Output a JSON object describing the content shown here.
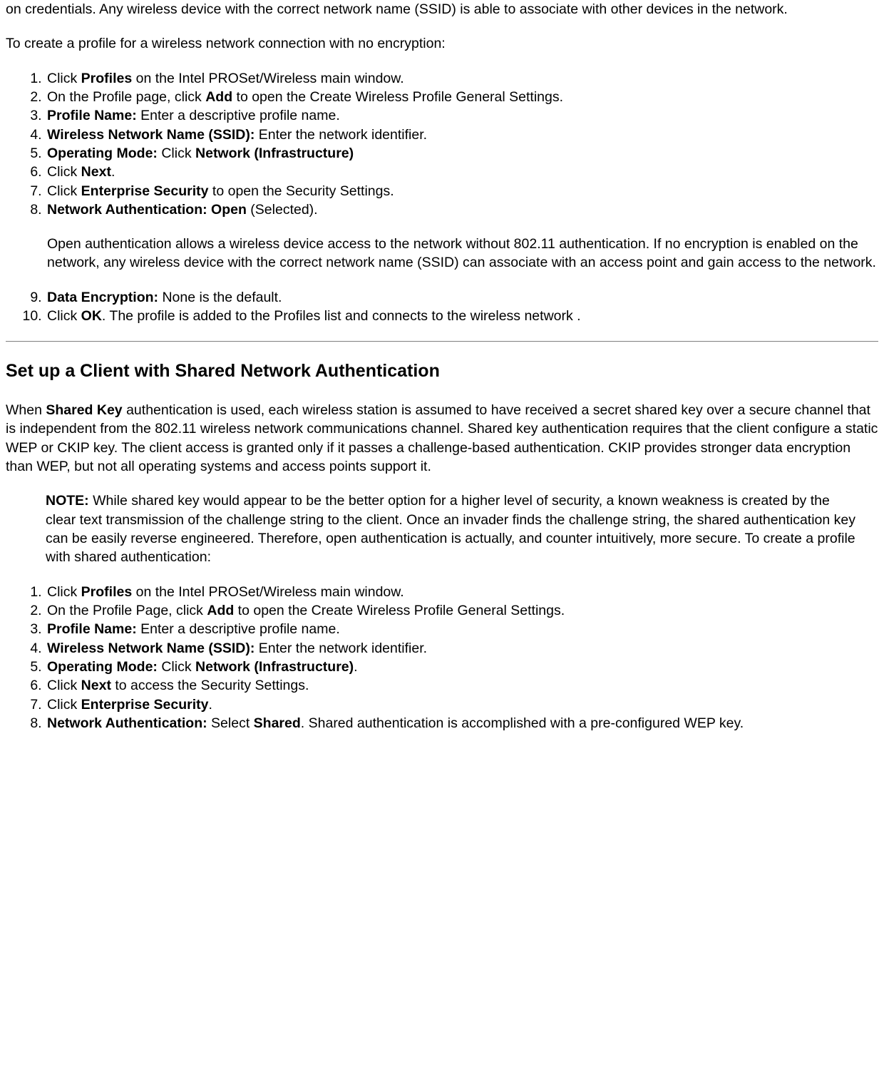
{
  "intro": {
    "p1": "on credentials. Any wireless device with the correct network name (SSID) is able to associate with other devices in the network.",
    "p2": "To create a profile for a wireless network connection with no encryption:"
  },
  "list1": {
    "i1_a": "Click ",
    "i1_b": "Profiles",
    "i1_c": " on the Intel PROSet/Wireless main window.",
    "i2_a": "On the Profile page, click ",
    "i2_b": "Add",
    "i2_c": " to open the Create Wireless Profile General Settings.",
    "i3_a": "Profile Name:",
    "i3_b": " Enter a descriptive profile name.",
    "i4_a": "Wireless Network Name (SSID):",
    "i4_b": " Enter the network identifier.",
    "i5_a": "Operating Mode:",
    "i5_b": " Click ",
    "i5_c": "Network (Infrastructure)",
    "i6_a": "Click ",
    "i6_b": "Next",
    "i6_c": ".",
    "i7_a": "Click ",
    "i7_b": "Enterprise Security",
    "i7_c": " to open the Security Settings.",
    "i8_a": "Network Authentication: Open",
    "i8_b": " (Selected).",
    "i8_para": "Open authentication allows a wireless device access to the network without 802.11 authentication. If no encryption is enabled on the network, any wireless device with the correct network name (SSID) can associate with an access point and gain access to the network.",
    "i9_a": "Data Encryption:",
    "i9_b": " None is the default.",
    "i10_a": "Click ",
    "i10_b": "OK",
    "i10_c": ". The profile is added to the Profiles list and connects to the wireless network ."
  },
  "section2": {
    "heading": "Set up a Client with Shared Network Authentication",
    "p_a": "When ",
    "p_b": "Shared Key",
    "p_c": " authentication is used, each wireless station is assumed to have received a secret shared key over a secure channel that is independent from the 802.11 wireless network communications channel. Shared key authentication requires that the client configure a static WEP or CKIP key. The client access is granted only if it passes a challenge-based authentication. CKIP provides stronger data encryption than WEP, but not all operating systems and access points support it.",
    "note_label": "NOTE:",
    "note_body": " While shared key would appear to be the better option for a higher level of security, a known weakness is created by the clear text transmission of the challenge string to the client. Once an invader finds the challenge string, the shared authentication key can be easily reverse engineered. Therefore, open authentication is actually, and counter intuitively, more secure. To create a profile with shared authentication:"
  },
  "list2": {
    "i1_a": "Click ",
    "i1_b": "Profiles",
    "i1_c": " on the Intel PROSet/Wireless main window.",
    "i2_a": "On the Profile Page, click ",
    "i2_b": "Add",
    "i2_c": " to open the Create Wireless Profile General Settings.",
    "i3_a": "Profile Name:",
    "i3_b": " Enter a descriptive profile name.",
    "i4_a": "Wireless Network Name (SSID):",
    "i4_b": " Enter the network identifier.",
    "i5_a": "Operating Mode:",
    "i5_b": " Click ",
    "i5_c": "Network (Infrastructure)",
    "i5_d": ".",
    "i6_a": "Click ",
    "i6_b": "Next",
    "i6_c": " to access the Security Settings.",
    "i7_a": "Click ",
    "i7_b": "Enterprise Security",
    "i7_c": ".",
    "i8_a": "Network Authentication:",
    "i8_b": " Select ",
    "i8_c": "Shared",
    "i8_d": ". Shared authentication is accomplished with a pre-configured WEP key."
  }
}
